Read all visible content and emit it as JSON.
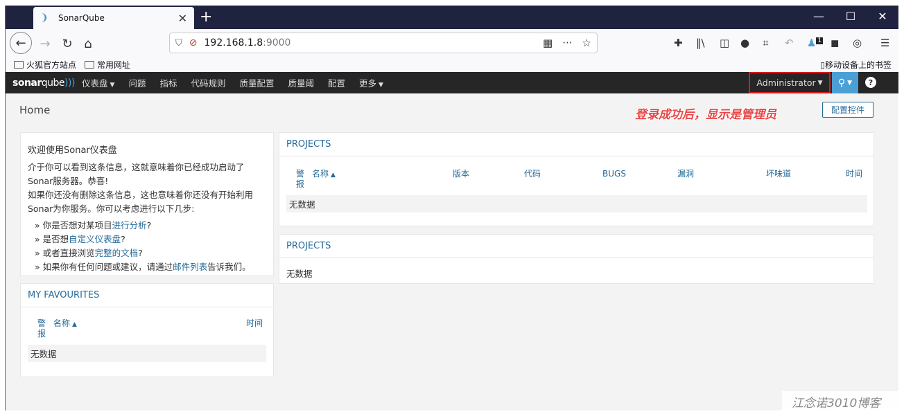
{
  "browser": {
    "tab_title": "SonarQube",
    "tab_close": "✕",
    "new_tab": "+",
    "url_host": "192.168.1.8",
    "url_port": ":9000",
    "bookmarks": [
      "火狐官方站点",
      "常用网址"
    ],
    "mobile_bookmarks": "移动设备上的书签",
    "extension_badge": "1"
  },
  "sonar": {
    "logo_bold": "sonar",
    "logo_light": "qube",
    "nav": [
      {
        "label": "仪表盘",
        "dropdown": true
      },
      {
        "label": "问题"
      },
      {
        "label": "指标"
      },
      {
        "label": "代码规则"
      },
      {
        "label": "质量配置"
      },
      {
        "label": "质量阈"
      },
      {
        "label": "配置"
      },
      {
        "label": "更多",
        "dropdown": true
      }
    ],
    "user": "Administrator",
    "help": "?"
  },
  "page": {
    "title": "Home",
    "annotation": "登录成功后，显示是管理员",
    "config_button": "配置控件"
  },
  "welcome": {
    "heading": "欢迎使用Sonar仪表盘",
    "p1": "介于你可以看到这条信息，这就意味着你已经成功启动了Sonar服务器。恭喜!",
    "p2": "如果你还没有删除这条信息，这也意味着你还没有开始利用Sonar为你服务。你可以考虑进行以下几步:",
    "items": [
      {
        "pre": "你是否想对某项目",
        "link": "进行分析",
        "post": "?"
      },
      {
        "pre": "是否想",
        "link": "自定义仪表盘",
        "post": "?"
      },
      {
        "pre": "或者直接浏览",
        "link": "完整的文档",
        "post": "?"
      },
      {
        "pre": "如果你有任何问题或建议，请通过",
        "link": "邮件列表",
        "post": "告诉我们。"
      }
    ]
  },
  "favourites": {
    "title": "MY FAVOURITES",
    "col_alert": "警报",
    "col_name": "名称",
    "col_time": "时间",
    "empty": "无数据"
  },
  "projects1": {
    "title": "PROJECTS",
    "col_alert": "警报",
    "col_name": "名称",
    "col_version": "版本",
    "col_code": "代码",
    "col_bugs": "BUGS",
    "col_vuln": "漏洞",
    "col_smell": "坏味道",
    "col_time": "时间",
    "empty": "无数据"
  },
  "projects2": {
    "title": "PROJECTS",
    "empty": "无数据"
  },
  "watermark": "江念诺3010博客"
}
